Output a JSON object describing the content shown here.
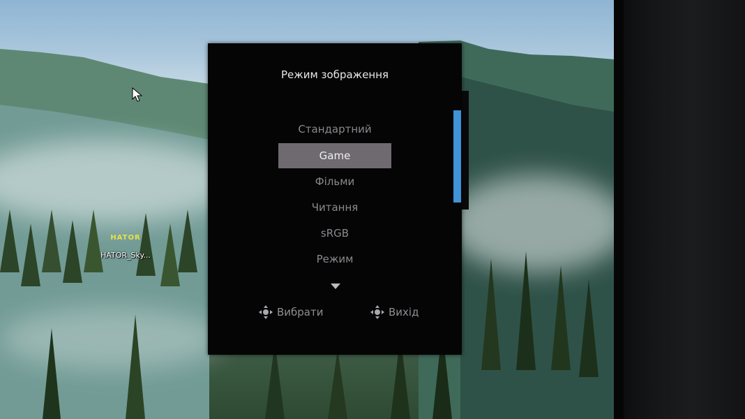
{
  "desktop": {
    "icon_logo": "HATOR",
    "icon_label": "HATOR_Sky..."
  },
  "osd": {
    "title": "Режим зображення",
    "items": [
      {
        "label": "Стандартний",
        "selected": false
      },
      {
        "label": "Game",
        "selected": true
      },
      {
        "label": "Фільми",
        "selected": false
      },
      {
        "label": "Читання",
        "selected": false
      },
      {
        "label": "sRGB",
        "selected": false
      },
      {
        "label": "Режим",
        "selected": false
      }
    ],
    "more_icon": "chevron-down-icon",
    "hint_select": "Вибрати",
    "hint_exit": "Вихід",
    "hint_icon": "joystick-icon"
  },
  "colors": {
    "selected_bg": "#6e6a70",
    "scrollbar": "#3f93d6",
    "logo": "#e7e04a"
  }
}
